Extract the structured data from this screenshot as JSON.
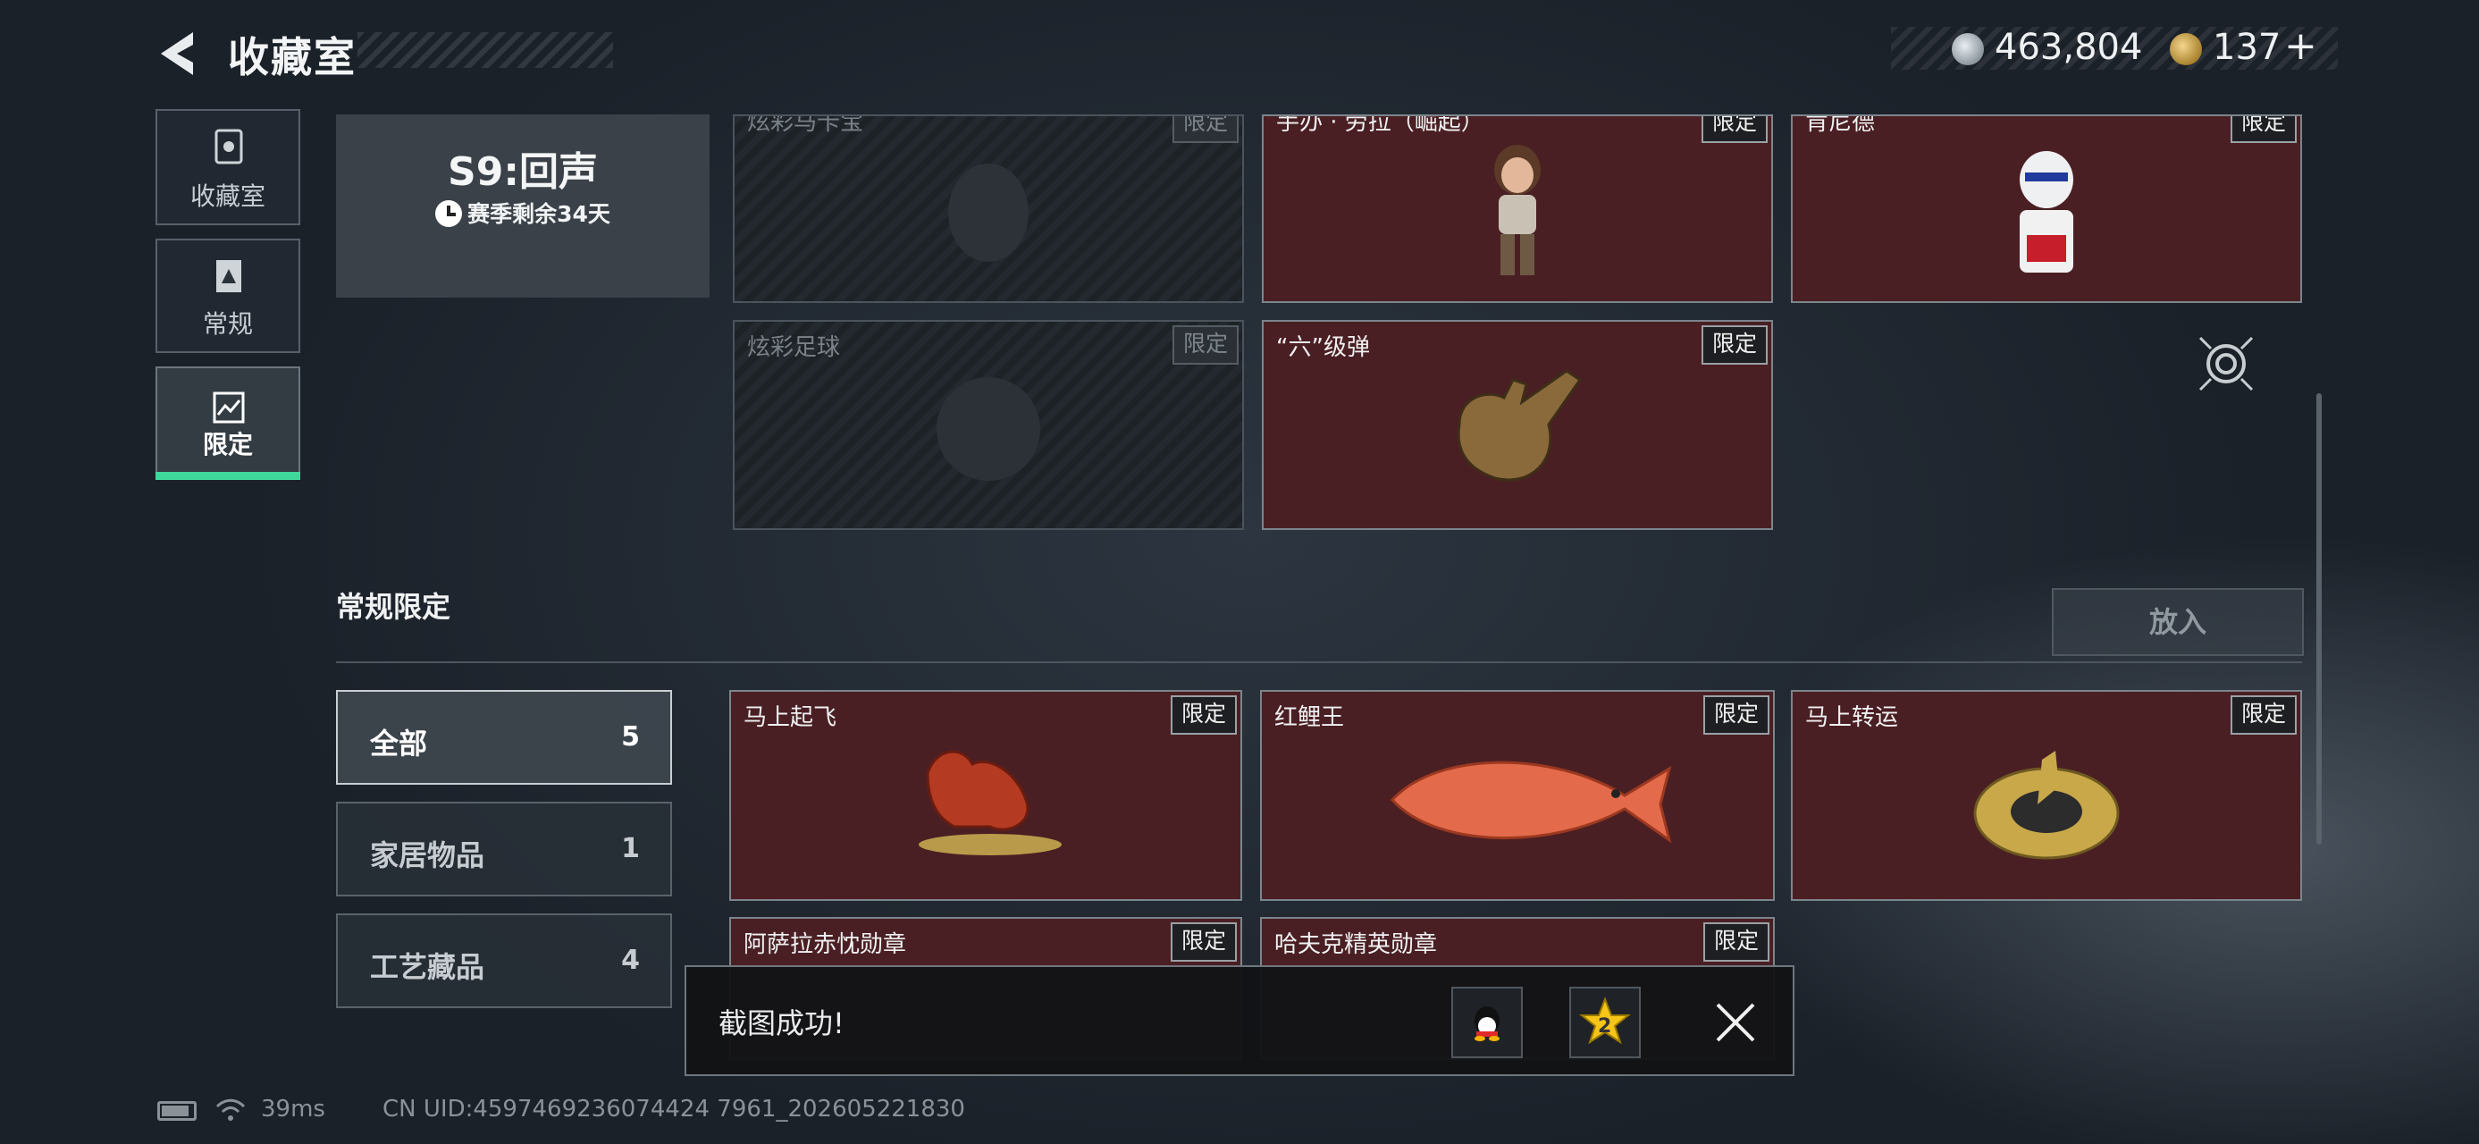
{
  "header": {
    "title": "收藏室",
    "currency_silver": "463,804",
    "currency_gold": "137",
    "gold_add": "+"
  },
  "nav": {
    "items": [
      {
        "label": "收藏室"
      },
      {
        "label": "常规"
      },
      {
        "label": "限定"
      }
    ]
  },
  "season": {
    "title": "S9:回声",
    "remaining": "赛季剩余34天"
  },
  "limited_top": [
    {
      "name": "炫彩马卡宝",
      "tag": "限定",
      "unlocked": false
    },
    {
      "name": "手办 · 劳拉（崛起）",
      "tag": "限定",
      "unlocked": true
    },
    {
      "name": "肯尼德",
      "tag": "限定",
      "unlocked": true
    },
    {
      "name": "炫彩足球",
      "tag": "限定",
      "unlocked": false
    },
    {
      "name": "“六”级弹",
      "tag": "限定",
      "unlocked": true
    }
  ],
  "section": {
    "title": "常规限定",
    "put_button": "放入"
  },
  "categories": [
    {
      "label": "全部",
      "count": "5"
    },
    {
      "label": "家居物品",
      "count": "1"
    },
    {
      "label": "工艺藏品",
      "count": "4"
    }
  ],
  "items": [
    {
      "name": "马上起飞",
      "tag": "限定"
    },
    {
      "name": "红鲤王",
      "tag": "限定"
    },
    {
      "name": "马上转运",
      "tag": "限定"
    },
    {
      "name": "阿萨拉赤忱勋章",
      "tag": "限定"
    },
    {
      "name": "哈夫克精英勋章",
      "tag": "限定"
    }
  ],
  "toast": {
    "text": "截图成功!",
    "badge": "2"
  },
  "status": {
    "ping": "39ms",
    "uid": "CN UID:4597469236074424 7961_202605221830"
  },
  "icons": {
    "back": "back-arrow-icon",
    "target": "target-icon",
    "close": "close-icon",
    "qq": "qq-icon",
    "star": "star-icon",
    "wifi": "wifi-icon",
    "battery": "battery-icon"
  },
  "colors": {
    "accent_green": "#3fd79a",
    "card_red": "#4a1f23",
    "background": "#1b2129"
  }
}
